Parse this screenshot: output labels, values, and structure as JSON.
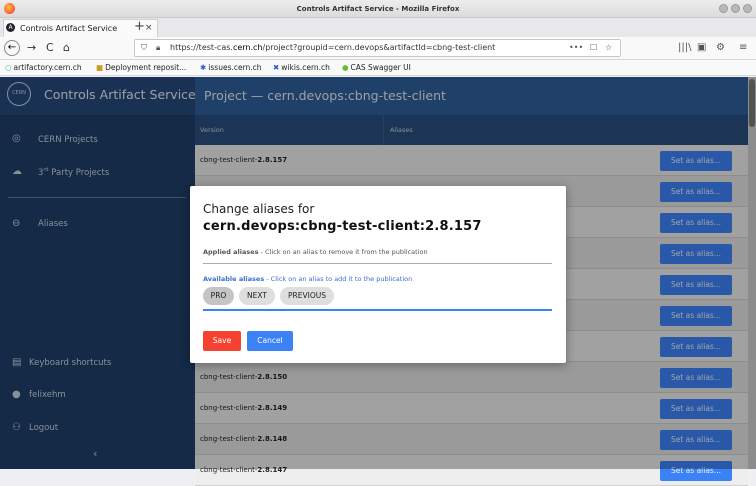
{
  "window": {
    "title": "Controls Artifact Service - Mozilla Firefox"
  },
  "tab": {
    "label": "Controls Artifact Service",
    "close": "×",
    "new_tab": "+"
  },
  "nav": {
    "back": "←",
    "forward": "→",
    "reload": "C",
    "home": "⌂",
    "url_prefix": "https://test-cas.",
    "url_domain": "cern.ch",
    "url_rest": "/project?groupid=cern.devops&artifactId=cbng-test-client",
    "page_actions": "•••",
    "pocket": "☐",
    "star": "☆",
    "library": "|||\\",
    "sidebar_toggle": "▣",
    "menu": "≡"
  },
  "bookmarks": [
    {
      "icon": "○",
      "label": "artifactory.cern.ch"
    },
    {
      "icon": "■",
      "label": "Deployment reposit..."
    },
    {
      "icon": "✱",
      "label": "issues.cern.ch"
    },
    {
      "icon": "✖",
      "label": "wikis.cern.ch"
    },
    {
      "icon": "●",
      "label": "CAS Swagger UI"
    }
  ],
  "sidebar": {
    "logo_text": "CERN",
    "app_title": "Controls Artifact Service",
    "items": [
      {
        "icon": "◎",
        "label": "CERN Projects"
      },
      {
        "icon": "☁",
        "label_main": "3",
        "label_sup": "rd",
        "label_rest": " Party Projects"
      },
      {
        "icon": "⊖",
        "label": "Aliases"
      }
    ],
    "bottom": [
      {
        "icon": "▤",
        "label": "Keyboard shortcuts"
      },
      {
        "icon": "●",
        "label": "felixehm"
      },
      {
        "icon": "⚇",
        "label": "Logout"
      }
    ],
    "collapse": "‹"
  },
  "main": {
    "title": "Project — cern.devops:cbng-test-client",
    "columns": [
      "Version",
      "Aliases"
    ],
    "rows": [
      {
        "prefix": "cbng-test-client-",
        "version": "2.8.157",
        "action": "Set as alias..."
      },
      {
        "prefix": "",
        "version": "",
        "action": "Set as alias..."
      },
      {
        "prefix": "",
        "version": "",
        "action": "Set as alias..."
      },
      {
        "prefix": "",
        "version": "",
        "action": "Set as alias..."
      },
      {
        "prefix": "",
        "version": "",
        "action": "Set as alias..."
      },
      {
        "prefix": "",
        "version": "",
        "action": "Set as alias..."
      },
      {
        "prefix": "",
        "version": "",
        "action": "Set as alias..."
      },
      {
        "prefix": "cbng-test-client-",
        "version": "2.8.150",
        "action": "Set as alias..."
      },
      {
        "prefix": "cbng-test-client-",
        "version": "2.8.149",
        "action": "Set as alias..."
      },
      {
        "prefix": "cbng-test-client-",
        "version": "2.8.148",
        "action": "Set as alias..."
      },
      {
        "prefix": "cbng-test-client-",
        "version": "2.8.147",
        "action": "Set as alias..."
      }
    ]
  },
  "dialog": {
    "title": "Change aliases for",
    "subtitle": "cern.devops:cbng-test-client:2.8.157",
    "applied_bold": "Applied aliases",
    "applied_hint": " - Click on an alias to remove it from the publication",
    "available_bold": "Available aliases",
    "available_hint": " - Click on an alias to add it to the publication",
    "chips": [
      "PRO",
      "NEXT",
      "PREVIOUS"
    ],
    "save": "Save",
    "cancel": "Cancel"
  },
  "colors": {
    "sidebar": "#1e3e67",
    "header": "#2f5f9a",
    "primary": "#3b82f7",
    "danger": "#f5412f"
  }
}
